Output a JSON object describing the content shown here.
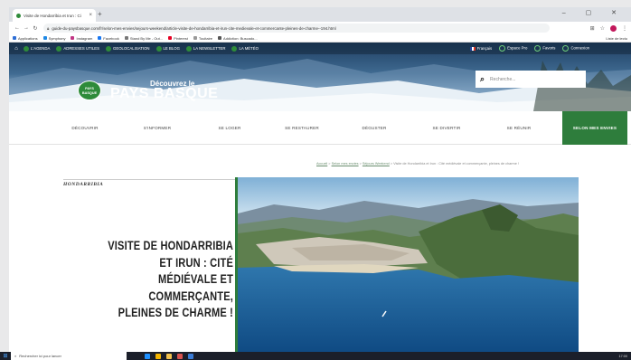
{
  "browser": {
    "tab_title": "Visite de Hondarribia et Irun : Ci",
    "tab_close": "×",
    "new_tab": "+",
    "window_controls": "–  ▢  ✕",
    "url": "guide-du-paysbasque.com/fr/selon-mes-envies/sejours-weekend/article-visite-de-hondarribia-et-irun-cite-medievale-et-commercante-pleines-de-charme--194.html",
    "bookmarks": [
      "Applications",
      "Symphony",
      "Instagram",
      "Facebook",
      "Stand By Me - Out...",
      "Pinterest",
      "Touitaire",
      "Addiction: Buscado..."
    ],
    "bookmark_colors": [
      "#2f6fd6",
      "#1e88e5",
      "#c13584",
      "#1877f2",
      "#777777",
      "#e60023",
      "#999999",
      "#555555"
    ],
    "other_bookmarks": "Liste de lectu"
  },
  "site": {
    "topbar": {
      "home_icon": "home-icon",
      "links": [
        "L'AGENDA",
        "ADRESSES UTILES",
        "GEOLOCALISATION",
        "LE BLOG",
        "LA NEWSLETTER",
        "LA MÉTÉO"
      ],
      "language": "Français",
      "espace_pro": "Espace Pro",
      "favoris": "Favoris",
      "connexion": "Connexion"
    },
    "logo": {
      "badge_line1": "PAYS",
      "badge_line2": "BASQUE",
      "small": "Découvrez le",
      "big": "PAYS BASQUE"
    },
    "search": {
      "placeholder": "Recherche..."
    },
    "menu": [
      "DÉCOUVRIR",
      "S'INFORMER",
      "SE LOGER",
      "SE RESTAURER",
      "DÉGUSTER",
      "SE DIVERTIR",
      "SE RÉUNIR",
      "SELON MES ENVIES"
    ],
    "menu_active_index": 7,
    "accent": "#2e7d3c"
  },
  "breadcrumb": {
    "items": [
      "Accueil",
      "Selon mes envies",
      "Séjours Weekend"
    ],
    "separator": " > ",
    "current": "Visite de Hondarribia et Irun : Cité médiévale et commerçante, pleines de charme !"
  },
  "article": {
    "section": "HONDARRIBIA",
    "title": "VISITE DE HONDARRIBIA ET IRUN : CITÉ MÉDIÉVALE ET COMMERÇANTE, PLEINES DE CHARME !"
  },
  "taskbar": {
    "search_placeholder": "Rechercher ici pour lancer",
    "time": "17:00"
  }
}
